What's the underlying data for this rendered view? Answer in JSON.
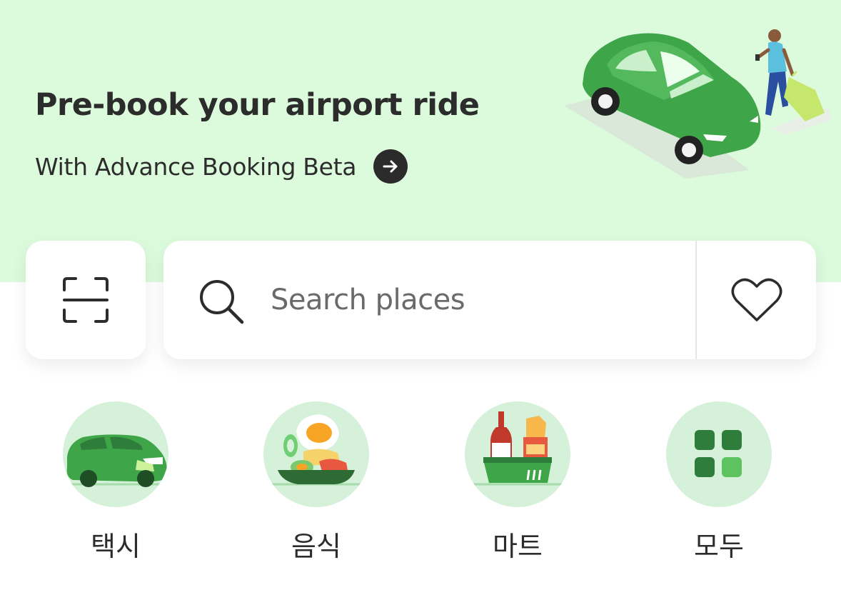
{
  "hero": {
    "title": "Pre-book your airport ride",
    "subtitle": "With Advance Booking Beta",
    "background_color": "#dcfadc",
    "arrow_icon": "arrow-right-icon",
    "illustration": "car-and-traveler-illustration"
  },
  "scan": {
    "icon": "scan-icon"
  },
  "search": {
    "placeholder": "Search places",
    "value": "",
    "search_icon": "search-icon",
    "favorites_icon": "heart-icon"
  },
  "services": [
    {
      "label": "택시",
      "icon": "taxi-car-icon"
    },
    {
      "label": "음식",
      "icon": "food-plate-icon"
    },
    {
      "label": "마트",
      "icon": "grocery-basket-icon"
    },
    {
      "label": "모두",
      "icon": "grid-all-icon"
    }
  ],
  "colors": {
    "brand_green": "#3fa64a",
    "dark_green": "#2e7d3a",
    "service_circle": "#d6f1d9",
    "text": "#2c2c2c"
  }
}
